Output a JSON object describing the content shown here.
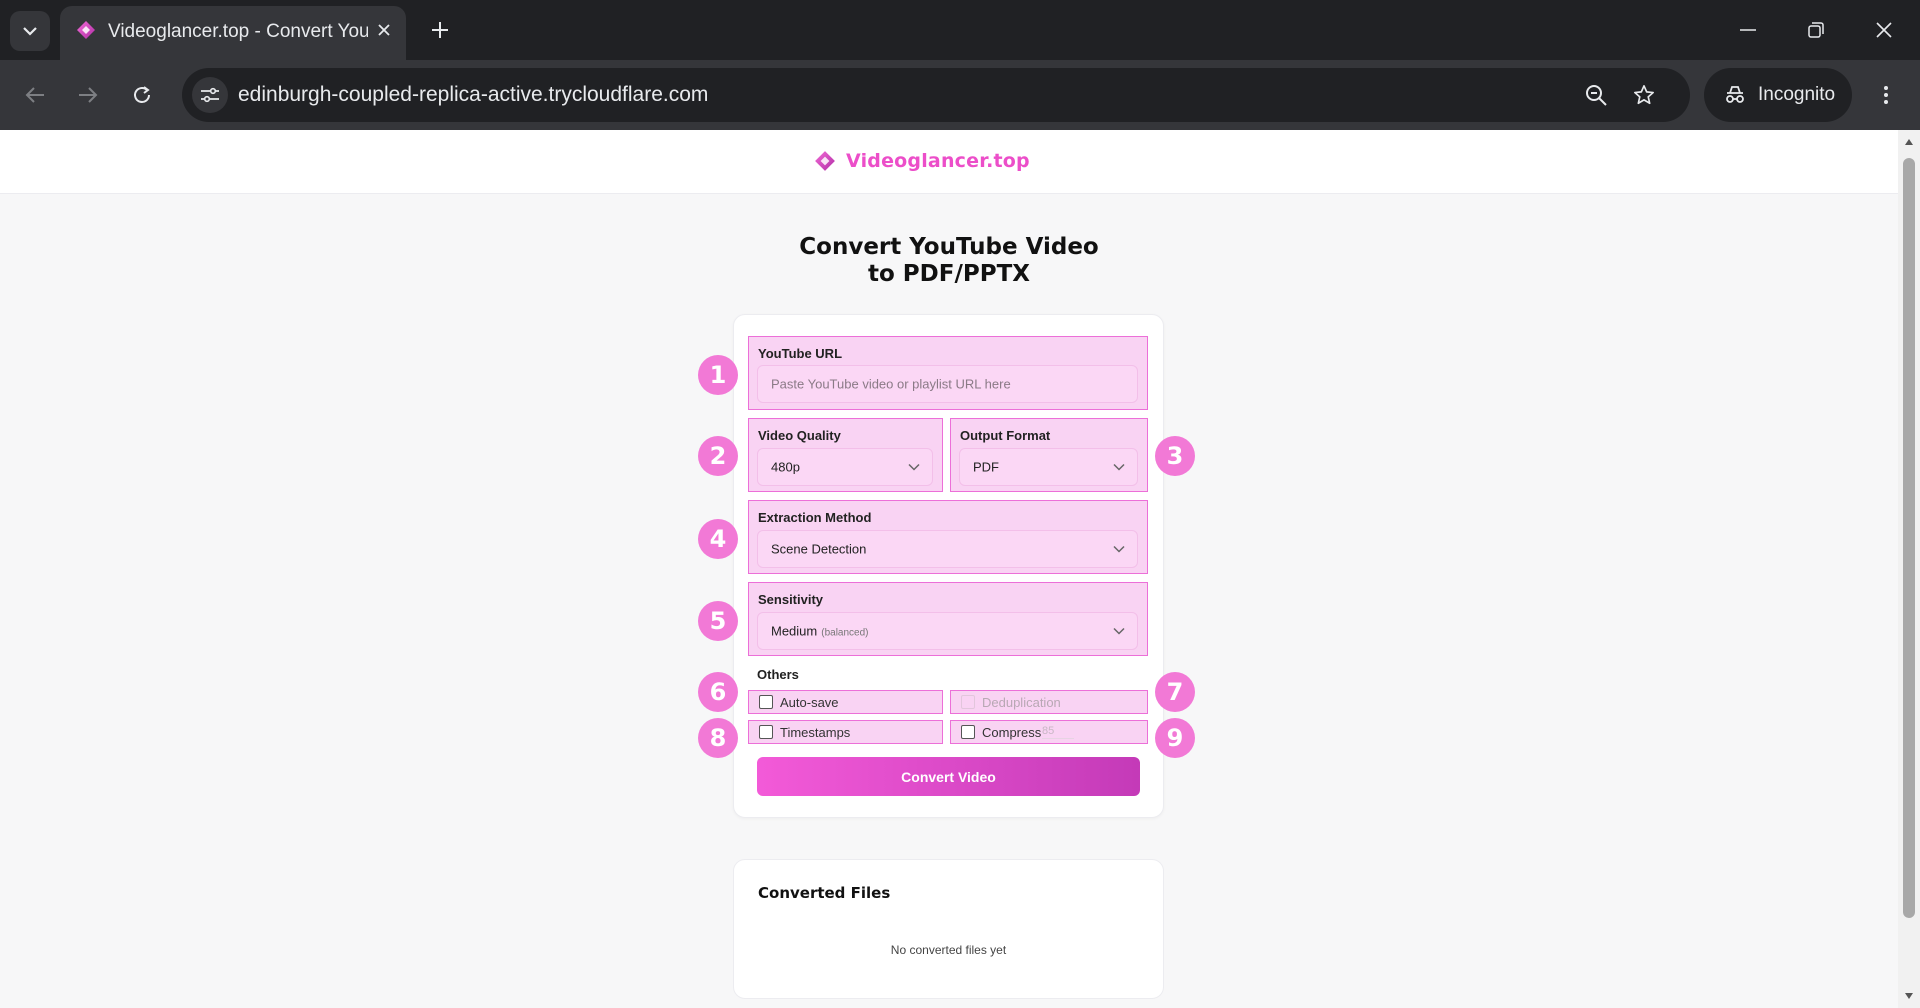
{
  "browser": {
    "tab_title": "Videoglancer.top - Convert YouTube Video to PDF/PPTX",
    "url": "edinburgh-coupled-replica-active.trycloudflare.com",
    "profile_label": "Incognito"
  },
  "header": {
    "brand": "Videoglancer.top"
  },
  "hero": {
    "title_line1": "Convert YouTube Video",
    "title_line2": "to PDF/PPTX"
  },
  "form": {
    "youtube_url": {
      "label": "YouTube URL",
      "placeholder": "Paste YouTube video or playlist URL here",
      "value": ""
    },
    "video_quality": {
      "label": "Video Quality",
      "value": "480p"
    },
    "output_format": {
      "label": "Output Format",
      "value": "PDF"
    },
    "extraction_method": {
      "label": "Extraction Method",
      "value": "Scene Detection"
    },
    "sensitivity": {
      "label": "Sensitivity",
      "value": "Medium",
      "hint": "(balanced)"
    },
    "others": {
      "label": "Others",
      "auto_save": "Auto-save",
      "deduplication": "Deduplication",
      "timestamps": "Timestamps",
      "compress": "Compress",
      "compress_value": "85"
    },
    "submit_label": "Convert Video"
  },
  "badges": [
    "1",
    "2",
    "3",
    "4",
    "5",
    "6",
    "7",
    "8",
    "9"
  ],
  "converted_files": {
    "title": "Converted Files",
    "empty_text": "No converted files yet"
  },
  "colors": {
    "accent": "#ec4ec9",
    "field_bg": "#f9d3f3",
    "field_border": "#ec6fd8",
    "badge": "#f279d6",
    "chrome_dark": "#202124",
    "chrome_mid": "#35363a"
  },
  "icons": {
    "tab_search": "chevron-down-icon",
    "favicon": "diamond-logo-icon",
    "close": "close-icon",
    "new_tab": "plus-icon",
    "back": "arrow-left-icon",
    "forward": "arrow-right-icon",
    "reload": "reload-icon",
    "site_info": "tune-icon",
    "zoom": "zoom-icon",
    "bookmark": "star-icon",
    "incognito": "incognito-icon",
    "menu": "kebab-menu-icon"
  }
}
